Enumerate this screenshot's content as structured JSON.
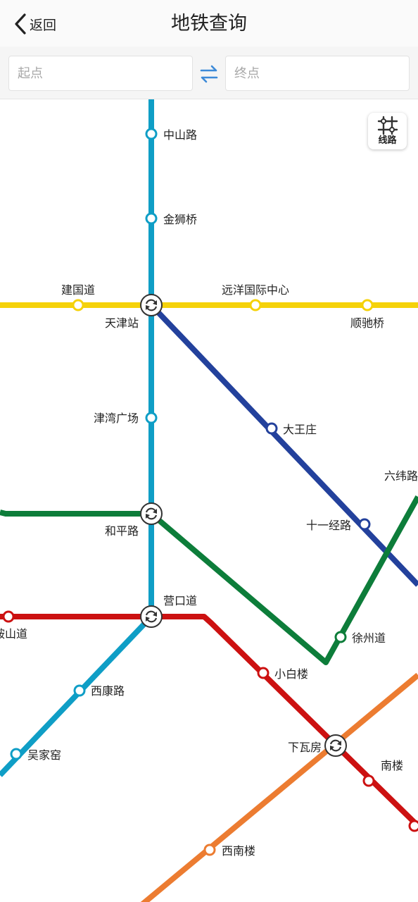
{
  "header": {
    "back_label": "返回",
    "title": "地铁查询"
  },
  "search": {
    "start_placeholder": "起点",
    "end_placeholder": "终点"
  },
  "route_button": {
    "label": "线路",
    "icon": "route-icon"
  },
  "lines": [
    {
      "color": "#0f9ec6"
    },
    {
      "color": "#f5d20a"
    },
    {
      "color": "#23419c"
    },
    {
      "color": "#0d7d3a"
    },
    {
      "color": "#cc1111"
    },
    {
      "color": "#ec7c31"
    }
  ],
  "stations": [
    {
      "name": "中山路",
      "transfer": false
    },
    {
      "name": "金狮桥",
      "transfer": false
    },
    {
      "name": "建国道",
      "transfer": false
    },
    {
      "name": "天津站",
      "transfer": true
    },
    {
      "name": "远洋国际中心",
      "transfer": false
    },
    {
      "name": "顺驰桥",
      "transfer": false
    },
    {
      "name": "津湾广场",
      "transfer": false
    },
    {
      "name": "大王庄",
      "transfer": false
    },
    {
      "name": "六纬路",
      "transfer": false
    },
    {
      "name": "和平路",
      "transfer": true
    },
    {
      "name": "十一经路",
      "transfer": false
    },
    {
      "name": "营口道",
      "transfer": true
    },
    {
      "name": "鞍山道",
      "transfer": false
    },
    {
      "name": "徐州道",
      "transfer": false
    },
    {
      "name": "小白楼",
      "transfer": false
    },
    {
      "name": "西康路",
      "transfer": false
    },
    {
      "name": "下瓦房",
      "transfer": true
    },
    {
      "name": "吴家窑",
      "transfer": false
    },
    {
      "name": "南楼",
      "transfer": false
    },
    {
      "name": "西南楼",
      "transfer": false
    },
    {
      "name": "",
      "transfer": false
    }
  ]
}
